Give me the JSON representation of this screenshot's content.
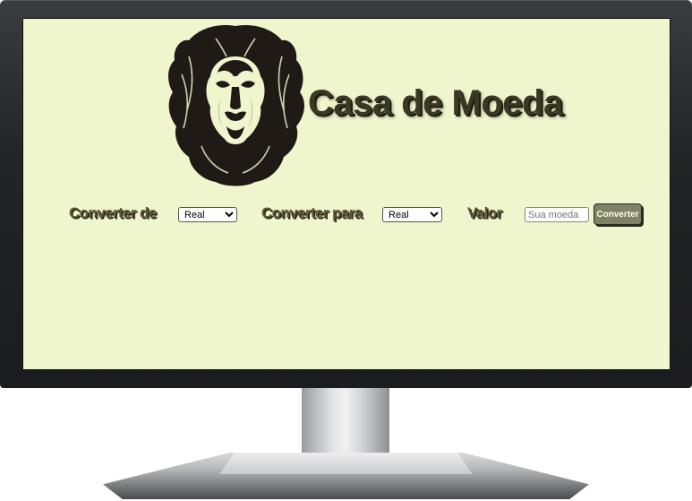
{
  "header": {
    "title": "Casa de Moeda",
    "logo": "lion-head-icon"
  },
  "converter": {
    "from_label": "Converter de",
    "from_selected": "Real",
    "to_label": "Converter para",
    "to_selected": "Real",
    "value_label": "Valor",
    "value_placeholder": "Sua moeda",
    "button_label": "Converter"
  },
  "colors": {
    "screen_bg": "#eff5cc",
    "title": "#3a3722",
    "label": "#5d5936",
    "button_bg": "#7d8266"
  }
}
